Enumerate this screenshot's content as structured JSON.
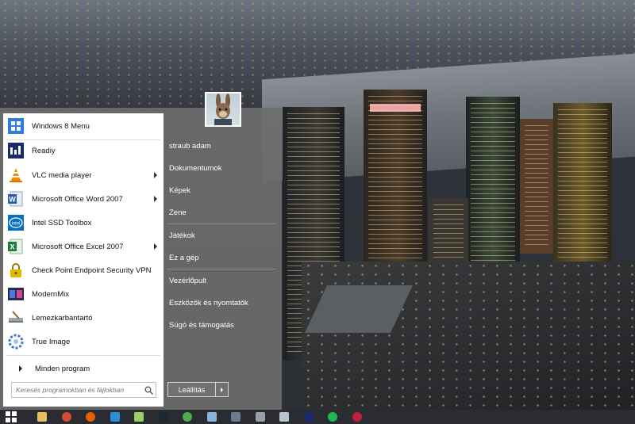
{
  "start_menu": {
    "user": {
      "name": "straub adam"
    },
    "programs": [
      {
        "label": "Windows 8 Menu",
        "icon": "windows-8-menu-icon",
        "color": "#1f6fd1",
        "submenu": false
      },
      {
        "label": "Readiy",
        "icon": "readiy-icon",
        "color": "#1b2a6b",
        "submenu": false
      },
      {
        "label": "VLC media player",
        "icon": "vlc-cone-icon",
        "color": "#f08a00",
        "submenu": true
      },
      {
        "label": "Microsoft Office Word 2007",
        "icon": "word-icon",
        "color": "#2a5caa",
        "submenu": true
      },
      {
        "label": "Intel SSD Toolbox",
        "icon": "intel-icon",
        "color": "#0a6fc2",
        "submenu": false
      },
      {
        "label": "Microsoft Office Excel 2007",
        "icon": "excel-icon",
        "color": "#1e7a3c",
        "submenu": true
      },
      {
        "label": "Check Point Endpoint Security VPN",
        "icon": "padlock-icon",
        "color": "#e3b600",
        "submenu": false
      },
      {
        "label": "ModernMix",
        "icon": "modernmix-icon",
        "color": "#2a2a4a",
        "submenu": false
      },
      {
        "label": "Lemezkarbantartó",
        "icon": "disk-cleanup-icon",
        "color": "#7a8a96",
        "submenu": false
      },
      {
        "label": "True Image",
        "icon": "true-image-icon",
        "color": "#3a7ad0",
        "submenu": false
      }
    ],
    "all_programs_label": "Minden program",
    "search": {
      "placeholder": "Keresés programokban és fájlokban"
    },
    "places": [
      {
        "label": "straub adam",
        "name": "user-folder"
      },
      {
        "label": "Dokumentumok",
        "name": "documents"
      },
      {
        "label": "Képek",
        "name": "pictures"
      },
      {
        "label": "Zene",
        "name": "music"
      },
      {
        "label": "Játékok",
        "name": "games"
      },
      {
        "label": "Ez a gép",
        "name": "this-pc"
      },
      {
        "label": "Vezérlőpult",
        "name": "control-panel"
      },
      {
        "label": "Eszközök és nyomtatók",
        "name": "devices-and-printers"
      },
      {
        "label": "Súgó és támogatás",
        "name": "help-and-support"
      }
    ],
    "shutdown": {
      "label": "Leállítás"
    }
  },
  "taskbar": {
    "apps": [
      {
        "name": "file-explorer",
        "icon": "folder-icon",
        "color": "#e8c062"
      },
      {
        "name": "chrome",
        "icon": "chrome-icon",
        "color": "#d84a38"
      },
      {
        "name": "firefox",
        "icon": "firefox-icon",
        "color": "#e66000"
      },
      {
        "name": "internet-explorer",
        "icon": "ie-icon",
        "color": "#2a8fd8"
      },
      {
        "name": "notepad",
        "icon": "notepad-icon",
        "color": "#9bcf6a"
      },
      {
        "name": "steam",
        "icon": "steam-icon",
        "color": "#1b2838"
      },
      {
        "name": "sync",
        "icon": "sync-icon",
        "color": "#4cae4c"
      },
      {
        "name": "tool",
        "icon": "scissors-icon",
        "color": "#8ab4d8"
      },
      {
        "name": "monitor-app",
        "icon": "monitor-icon",
        "color": "#6a7c90"
      },
      {
        "name": "alien-app",
        "icon": "alien-icon",
        "color": "#9aa0a6"
      },
      {
        "name": "document-app",
        "icon": "document-icon",
        "color": "#b8c4d0"
      },
      {
        "name": "readiy-app",
        "icon": "readiy-icon",
        "color": "#1b2a6b"
      },
      {
        "name": "spotify",
        "icon": "spotify-icon",
        "color": "#1db954"
      },
      {
        "name": "media-player",
        "icon": "play-icon",
        "color": "#c0203a"
      }
    ]
  }
}
